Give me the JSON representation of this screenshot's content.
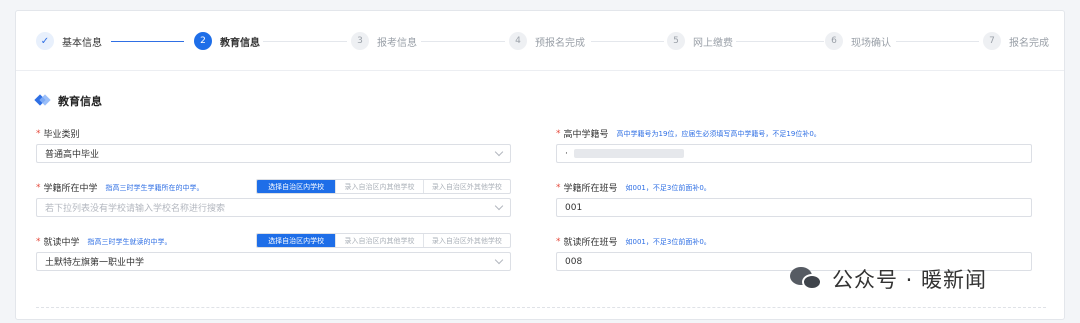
{
  "steps": [
    {
      "num": "1",
      "label": "基本信息",
      "state": "done"
    },
    {
      "num": "2",
      "label": "教育信息",
      "state": "active"
    },
    {
      "num": "3",
      "label": "报考信息",
      "state": "todo"
    },
    {
      "num": "4",
      "label": "预报名完成",
      "state": "todo"
    },
    {
      "num": "5",
      "label": "网上缴费",
      "state": "todo"
    },
    {
      "num": "6",
      "label": "现场确认",
      "state": "todo"
    },
    {
      "num": "7",
      "label": "报名完成",
      "state": "todo"
    }
  ],
  "icons": {
    "step_done": "check-icon",
    "section": "diamond-icon",
    "select": "chevron-down-icon"
  },
  "colors": {
    "accent": "#1e6ee8",
    "required": "#e54a3c"
  },
  "section_title": "教育信息",
  "required_mark": "*",
  "fields": {
    "graduation_type": {
      "label": "毕业类别",
      "value": "普通高中毕业"
    },
    "school": {
      "label": "学籍所在中学",
      "hint": "指高三时学生学籍所在的中学。",
      "placeholder": "若下拉列表没有学校请输入学校名称进行搜索",
      "options": [
        "选择自治区内学校",
        "录入自治区内其他学校",
        "录入自治区外其他学校"
      ]
    },
    "attend_school": {
      "label": "就读中学",
      "hint": "指高三时学生就读的中学。",
      "value": "土默特左旗第一职业中学",
      "options": [
        "选择自治区内学校",
        "录入自治区内其他学校",
        "录入自治区外其他学校"
      ]
    },
    "student_id": {
      "label": "高中学籍号",
      "hint": "高中学籍号为19位，应届生必须填写高中学籍号，不足19位补0。",
      "value": "·"
    },
    "class_no": {
      "label": "学籍所在班号",
      "hint": "如001，不足3位前面补0。",
      "value": "001"
    },
    "attend_class_no": {
      "label": "就读所在班号",
      "hint": "如001，不足3位前面补0。",
      "value": "008"
    }
  },
  "watermark": {
    "icon": "wechat-icon",
    "text": "公众号 · 暖新闻"
  }
}
